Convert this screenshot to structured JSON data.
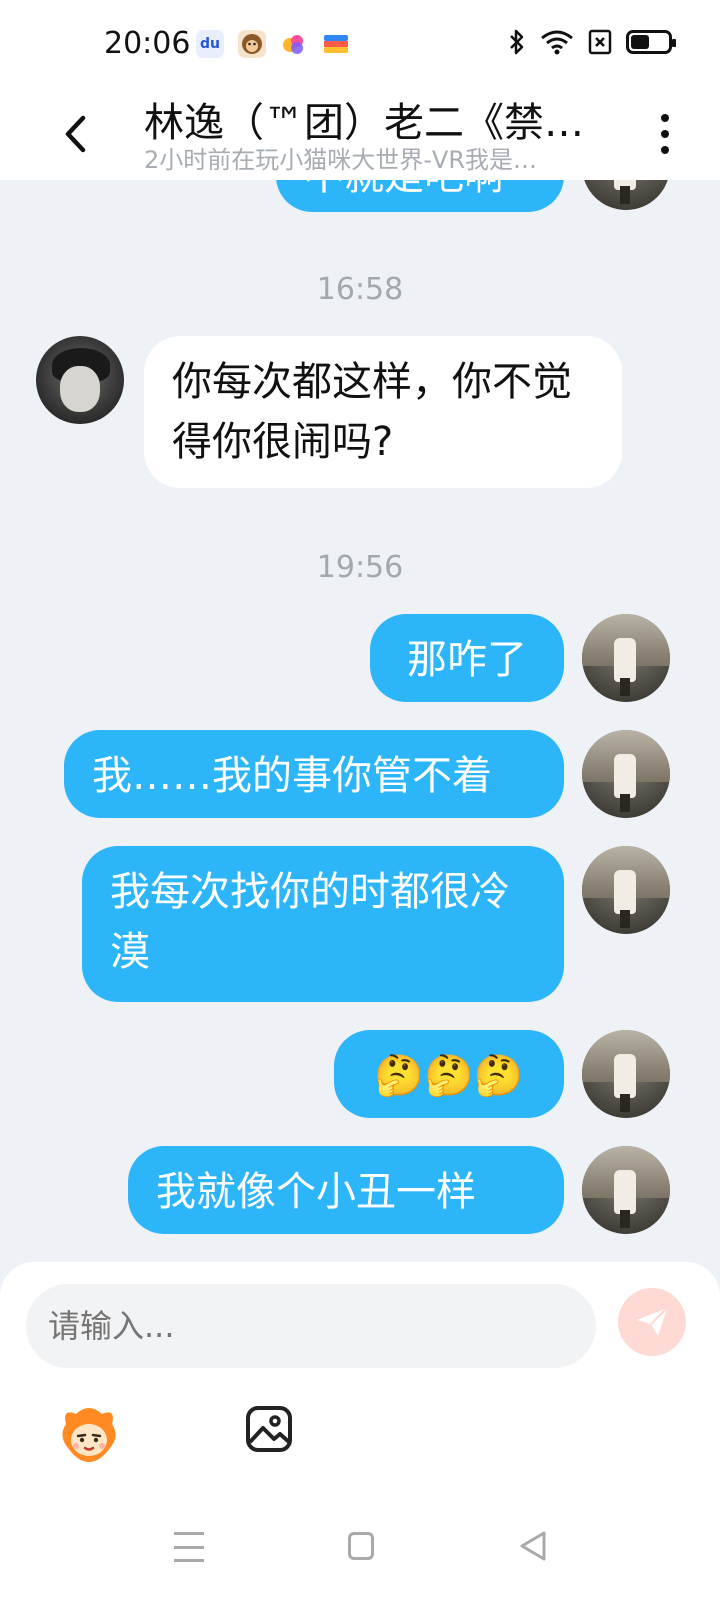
{
  "status_bar": {
    "time": "20:06",
    "battery_level": 0.5,
    "icons": [
      "baidu-app-icon",
      "monkey-app-icon",
      "colorful-app-icon",
      "wallet-app-icon",
      "bluetooth-icon",
      "wifi-icon",
      "sim-x-icon",
      "battery-icon"
    ]
  },
  "header": {
    "title": "林逸（™团）老二《禁…",
    "subtitle": "2小时前在玩小猫咪大世界-VR我是…"
  },
  "messages": {
    "partial_top": {
      "text": "不就是吧啊",
      "sender": "me"
    },
    "time1": "16:58",
    "m1": {
      "text": "你每次都这样，你不觉得你很闹吗?",
      "sender": "them"
    },
    "time2": "19:56",
    "m2": {
      "text": "那咋了",
      "sender": "me"
    },
    "m3": {
      "text": "我……我的事你管不着",
      "sender": "me"
    },
    "m4": {
      "text": "我每次找你的时都很冷漠",
      "sender": "me"
    },
    "m5": {
      "text": "🤔🤔🤔",
      "sender": "me"
    },
    "m6": {
      "text": "我就像个小丑一样",
      "sender": "me"
    }
  },
  "input": {
    "placeholder": "请输入..."
  },
  "colors": {
    "my_bubble": "#2db5fa",
    "their_bubble": "#ffffff",
    "background": "#eef2f6",
    "send_button": "#ffd9d4"
  }
}
